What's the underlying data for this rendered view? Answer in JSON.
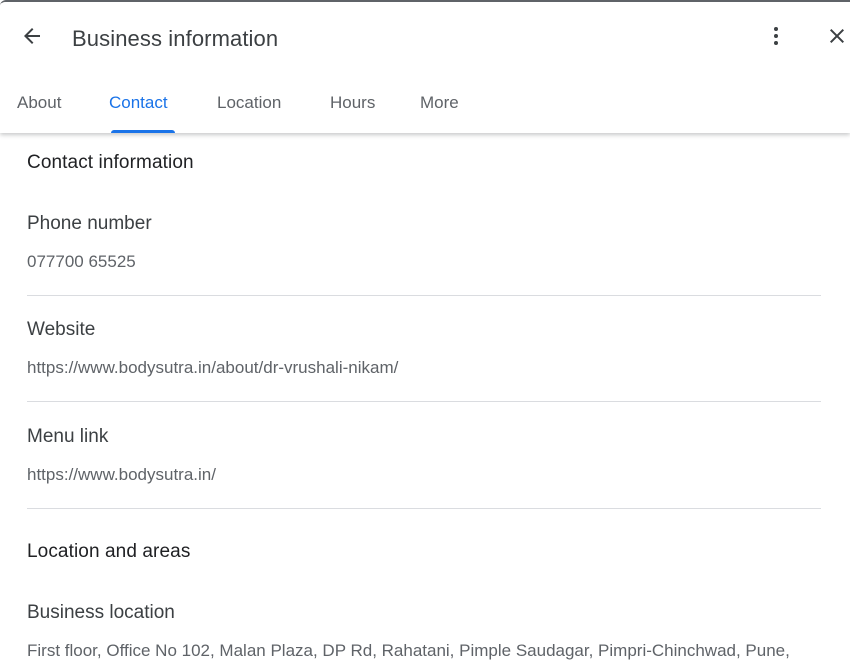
{
  "header": {
    "title": "Business information",
    "back_icon": "arrow-left-icon",
    "more_icon": "more-vertical-icon",
    "close_icon": "close-icon"
  },
  "tabs": [
    {
      "label": "About",
      "active": false
    },
    {
      "label": "Contact",
      "active": true
    },
    {
      "label": "Location",
      "active": false
    },
    {
      "label": "Hours",
      "active": false
    },
    {
      "label": "More",
      "active": false
    }
  ],
  "colors": {
    "accent": "#1a73e8",
    "divider": "#dadce0",
    "text_primary": "#202124",
    "text_secondary": "#5f6368"
  },
  "contact": {
    "section_title": "Contact information",
    "phone": {
      "label": "Phone number",
      "value": "077700 65525"
    },
    "website": {
      "label": "Website",
      "value": "https://www.bodysutra.in/about/dr-vrushali-nikam/"
    },
    "menu_link": {
      "label": "Menu link",
      "value": "https://www.bodysutra.in/"
    }
  },
  "location": {
    "section_title": "Location and areas",
    "business_location": {
      "label": "Business location",
      "value": "First floor, Office No 102, Malan Plaza, DP Rd, Rahatani, Pimple Saudagar, Pimpri-Chinchwad, Pune,"
    }
  }
}
